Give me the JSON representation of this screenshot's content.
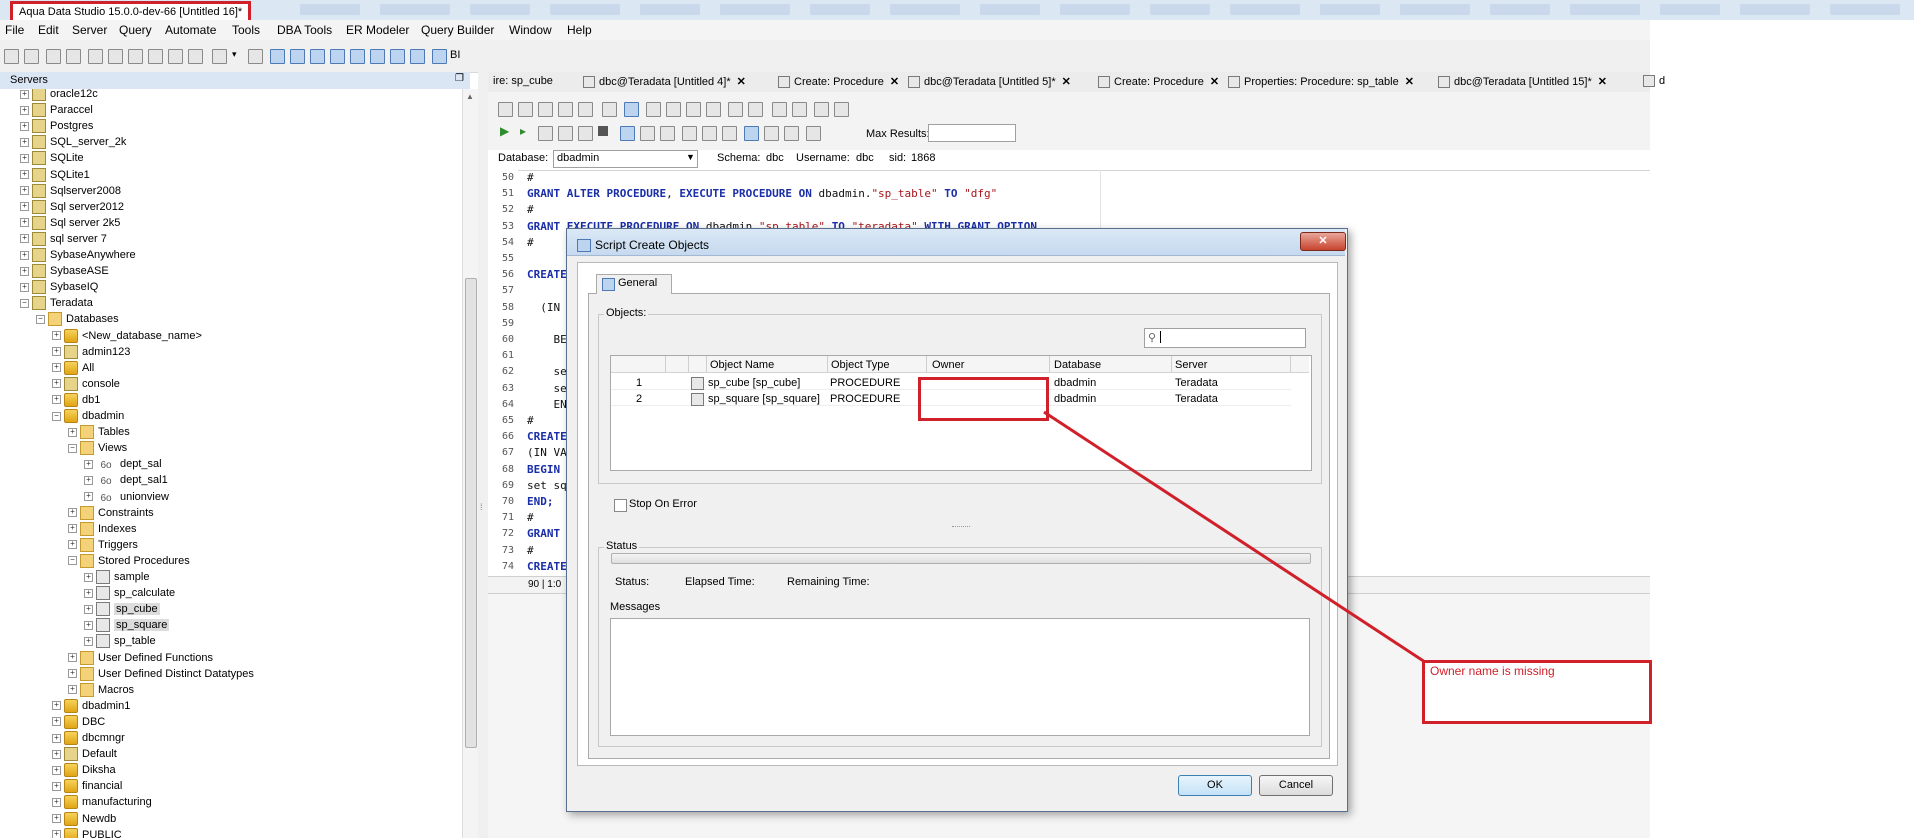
{
  "window": {
    "title": "Aqua Data Studio 15.0.0-dev-66 [Untitled 16]*"
  },
  "menu": [
    "File",
    "Edit",
    "Server",
    "Query",
    "Automate",
    "Tools",
    "DBA Tools",
    "ER Modeler",
    "Query Builder",
    "Window",
    "Help"
  ],
  "toolbar": {
    "bi_label": "BI"
  },
  "servers_panel": {
    "title": "Servers",
    "tree": [
      {
        "label": "oracle12c",
        "level": 0,
        "icon": "server"
      },
      {
        "label": "Paraccel",
        "level": 0,
        "icon": "server"
      },
      {
        "label": "Postgres",
        "level": 0,
        "icon": "server"
      },
      {
        "label": "SQL_server_2k",
        "level": 0,
        "icon": "server"
      },
      {
        "label": "SQLite",
        "level": 0,
        "icon": "server"
      },
      {
        "label": "SQLite1",
        "level": 0,
        "icon": "server"
      },
      {
        "label": "Sqlserver2008",
        "level": 0,
        "icon": "server"
      },
      {
        "label": "Sql server2012",
        "level": 0,
        "icon": "server"
      },
      {
        "label": "Sql server 2k5",
        "level": 0,
        "icon": "server"
      },
      {
        "label": "sql server 7",
        "level": 0,
        "icon": "server"
      },
      {
        "label": "SybaseAnywhere",
        "level": 0,
        "icon": "server"
      },
      {
        "label": "SybaseASE",
        "level": 0,
        "icon": "server"
      },
      {
        "label": "SybaseIQ",
        "level": 0,
        "icon": "server"
      },
      {
        "label": "Teradata",
        "level": 0,
        "icon": "server",
        "expanded": true
      },
      {
        "label": "Databases",
        "level": 1,
        "icon": "folder",
        "expanded": true
      },
      {
        "label": "<New_database_name>",
        "level": 2,
        "icon": "db"
      },
      {
        "label": "admin123",
        "level": 2,
        "icon": "user"
      },
      {
        "label": "All",
        "level": 2,
        "icon": "db"
      },
      {
        "label": "console",
        "level": 2,
        "icon": "user"
      },
      {
        "label": "db1",
        "level": 2,
        "icon": "db"
      },
      {
        "label": "dbadmin",
        "level": 2,
        "icon": "db",
        "expanded": true
      },
      {
        "label": "Tables",
        "level": 3,
        "icon": "folder"
      },
      {
        "label": "Views",
        "level": 3,
        "icon": "folder",
        "expanded": true
      },
      {
        "label": "dept_sal",
        "level": 4,
        "icon": "view"
      },
      {
        "label": "dept_sal1",
        "level": 4,
        "icon": "view"
      },
      {
        "label": "unionview",
        "level": 4,
        "icon": "view"
      },
      {
        "label": "Constraints",
        "level": 3,
        "icon": "folder"
      },
      {
        "label": "Indexes",
        "level": 3,
        "icon": "folder"
      },
      {
        "label": "Triggers",
        "level": 3,
        "icon": "folder"
      },
      {
        "label": "Stored Procedures",
        "level": 3,
        "icon": "folder",
        "expanded": true
      },
      {
        "label": "sample",
        "level": 4,
        "icon": "proc"
      },
      {
        "label": "sp_calculate",
        "level": 4,
        "icon": "proc"
      },
      {
        "label": "sp_cube",
        "level": 4,
        "icon": "proc",
        "selected": true
      },
      {
        "label": "sp_square",
        "level": 4,
        "icon": "proc",
        "selected": true
      },
      {
        "label": "sp_table",
        "level": 4,
        "icon": "proc"
      },
      {
        "label": "User Defined Functions",
        "level": 3,
        "icon": "folder"
      },
      {
        "label": "User Defined Distinct Datatypes",
        "level": 3,
        "icon": "folder"
      },
      {
        "label": "Macros",
        "level": 3,
        "icon": "folder"
      },
      {
        "label": "dbadmin1",
        "level": 2,
        "icon": "db"
      },
      {
        "label": "DBC",
        "level": 2,
        "icon": "db"
      },
      {
        "label": "dbcmngr",
        "level": 2,
        "icon": "db"
      },
      {
        "label": "Default",
        "level": 2,
        "icon": "user"
      },
      {
        "label": "Diksha",
        "level": 2,
        "icon": "db"
      },
      {
        "label": "financial",
        "level": 2,
        "icon": "db"
      },
      {
        "label": "manufacturing",
        "level": 2,
        "icon": "db"
      },
      {
        "label": "Newdb",
        "level": 2,
        "icon": "db"
      },
      {
        "label": "PUBLIC",
        "level": 2,
        "icon": "db"
      }
    ]
  },
  "editor_tabs": [
    {
      "label": "ire: sp_cube",
      "closable": false
    },
    {
      "label": "dbc@Teradata [Untitled 4]*",
      "closable": true
    },
    {
      "label": "Create: Procedure",
      "closable": true
    },
    {
      "label": "dbc@Teradata [Untitled 5]*",
      "closable": true
    },
    {
      "label": "Create: Procedure",
      "closable": true
    },
    {
      "label": "Properties: Procedure: sp_table",
      "closable": true
    },
    {
      "label": "dbc@Teradata [Untitled 15]*",
      "closable": true
    },
    {
      "label": "d",
      "closable": false
    }
  ],
  "editor": {
    "max_results_label": "Max Results:",
    "database_label": "Database:",
    "database_value": "dbadmin",
    "schema_label": "Schema:",
    "schema_value": "dbc",
    "username_label": "Username:",
    "username_value": "dbc",
    "sid_label": "sid:",
    "sid_value": "1868",
    "cursor_position": "90 | 1:0",
    "lines": [
      {
        "n": "50",
        "text": "#"
      },
      {
        "n": "51",
        "text": "GRANT ALTER PROCEDURE, EXECUTE PROCEDURE ON dbadmin.\"sp_table\" TO \"dfg\""
      },
      {
        "n": "52",
        "text": "#"
      },
      {
        "n": "53",
        "text": "GRANT EXECUTE PROCEDURE ON dbadmin.\"sp_table\" TO \"teradata\" WITH GRANT OPTION"
      },
      {
        "n": "54",
        "text": "#"
      },
      {
        "n": "55",
        "text": ""
      },
      {
        "n": "56",
        "text": "CREATE"
      },
      {
        "n": "57",
        "text": ""
      },
      {
        "n": "58",
        "text": "  (IN"
      },
      {
        "n": "59",
        "text": ""
      },
      {
        "n": "60",
        "text": "    BE"
      },
      {
        "n": "61",
        "text": ""
      },
      {
        "n": "62",
        "text": "    se"
      },
      {
        "n": "63",
        "text": "    se"
      },
      {
        "n": "64",
        "text": "    EN"
      },
      {
        "n": "65",
        "text": "#"
      },
      {
        "n": "66",
        "text": "CREATE"
      },
      {
        "n": "67",
        "text": "(IN VA"
      },
      {
        "n": "68",
        "text": "BEGIN"
      },
      {
        "n": "69",
        "text": "set sq"
      },
      {
        "n": "70",
        "text": "END;"
      },
      {
        "n": "71",
        "text": "#"
      },
      {
        "n": "72",
        "text": "GRANT"
      },
      {
        "n": "73",
        "text": "#"
      },
      {
        "n": "74",
        "text": "CREATE"
      }
    ]
  },
  "dialog": {
    "title": "Script Create Objects",
    "close_label": "✕",
    "tab_label": "General",
    "objects_label": "Objects:",
    "search_placeholder": "",
    "columns": [
      "",
      "",
      "Object Name",
      "Object Type",
      "Owner",
      "Database",
      "Server"
    ],
    "rows": [
      {
        "num": "1",
        "name": "sp_cube [sp_cube]",
        "type": "PROCEDURE",
        "owner": "",
        "database": "dbadmin",
        "server": "Teradata"
      },
      {
        "num": "2",
        "name": "sp_square [sp_square]",
        "type": "PROCEDURE",
        "owner": "",
        "database": "dbadmin",
        "server": "Teradata"
      }
    ],
    "stop_on_error_label": "Stop On Error",
    "status_group_label": "Status",
    "status_label": "Status:",
    "elapsed_label": "Elapsed Time:",
    "remaining_label": "Remaining Time:",
    "messages_label": "Messages",
    "progress": 0,
    "ok_label": "OK",
    "cancel_label": "Cancel"
  },
  "annotation": {
    "note": "Owner name is missing",
    "color": "#d0202a"
  }
}
